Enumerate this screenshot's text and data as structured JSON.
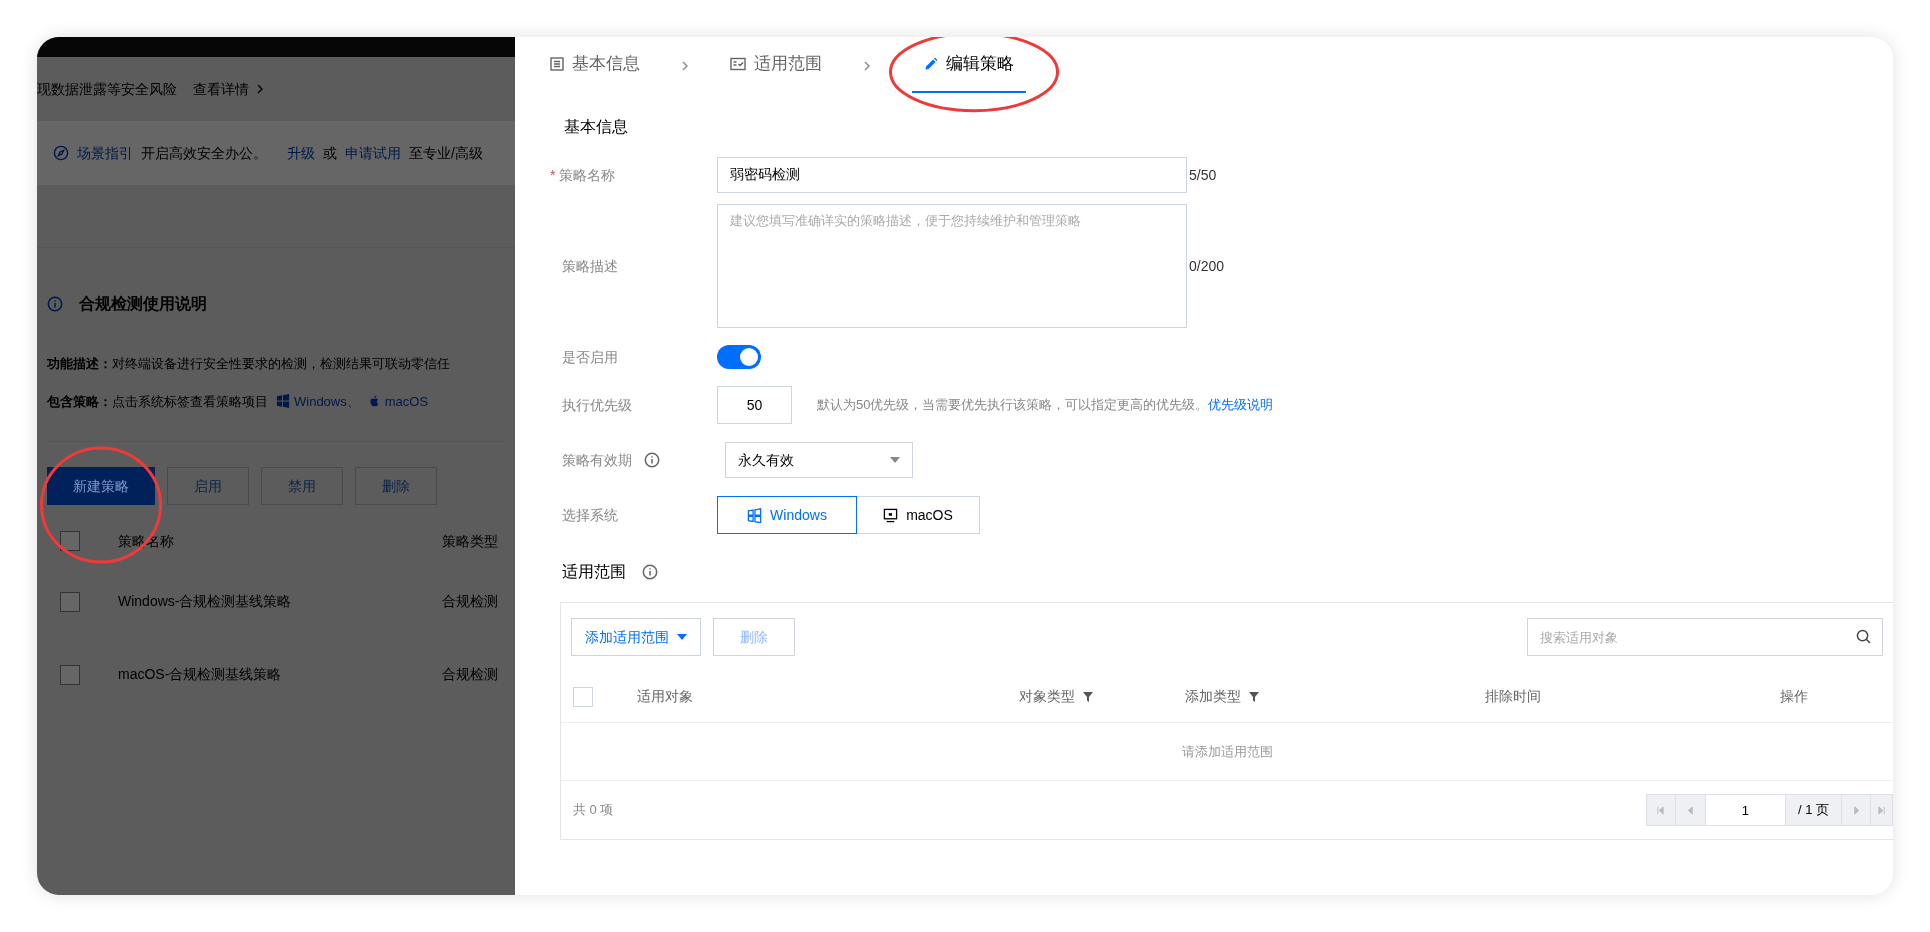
{
  "background_page": {
    "notice": {
      "text": "现数据泄露等安全风险",
      "link": "查看详情"
    },
    "banner": {
      "guide_link": "场景指引",
      "text_1": "开启高效安全办公。",
      "upgrade_link": "升级",
      "text_2": "或",
      "trial_link": "申请试用",
      "text_3": "至专业/高级"
    },
    "info": {
      "title": "合规检测使用说明",
      "description_label": "功能描述：",
      "description": "对终端设备进行安全性要求的检测，检测结果可联动零信任",
      "policies_label": "包含策略：",
      "policies_text": "点击系统标签查看策略项目",
      "systems": [
        {
          "kind": "windows",
          "label": "Windows、"
        },
        {
          "kind": "apple",
          "label": "macOS"
        }
      ]
    },
    "buttons": [
      {
        "label": "新建策略",
        "kind": "primary",
        "highlighted": true
      },
      {
        "label": "启用",
        "kind": "default",
        "highlighted": false
      },
      {
        "label": "禁用",
        "kind": "default",
        "highlighted": false
      },
      {
        "label": "删除",
        "kind": "default",
        "highlighted": false
      }
    ],
    "table": {
      "columns": [
        "策略名称",
        "策略类型"
      ],
      "header_checked": false,
      "rows": [
        {
          "checked": false,
          "cells": [
            "Windows-合规检测基线策略",
            "合规检测"
          ]
        },
        {
          "checked": false,
          "cells": [
            "macOS-合规检测基线策略",
            "合规检测"
          ]
        }
      ]
    }
  },
  "steps": [
    {
      "label": "基本信息",
      "kind": "list",
      "selected": false,
      "highlighted": false
    },
    {
      "label": "适用范围",
      "kind": "check",
      "selected": false,
      "highlighted": false
    },
    {
      "label": "编辑策略",
      "kind": "edit",
      "selected": true,
      "highlighted": true
    }
  ],
  "section_title": "基本信息",
  "form": {
    "name": {
      "label": "策略名称",
      "required_mark": "*",
      "value": "弱密码检测",
      "counter": "5/50"
    },
    "description": {
      "label": "策略描述",
      "placeholder": "建议您填写准确详实的策略描述，便于您持续维护和管理策略",
      "counter": "0/200"
    },
    "enabled": {
      "label": "是否启用",
      "on": true
    },
    "priority": {
      "label": "执行优先级",
      "value": "50",
      "hint": "默认为50优先级，当需要优先执行该策略，可以指定更高的优先级。",
      "link": "优先级说明"
    },
    "validity": {
      "label": "策略有效期",
      "value": "永久有效"
    },
    "system": {
      "label": "选择系统",
      "options": [
        {
          "label": "Windows",
          "kind": "windows",
          "selected": true
        },
        {
          "label": "macOS",
          "kind": "mac",
          "selected": false
        }
      ]
    }
  },
  "scope": {
    "title": "适用范围",
    "add_button": "添加适用范围",
    "delete_button": "删除",
    "search_placeholder": "搜索适用对象",
    "columns": [
      {
        "label": "适用对象",
        "filter": false
      },
      {
        "label": "对象类型",
        "filter": true
      },
      {
        "label": "添加类型",
        "filter": true
      },
      {
        "label": "排除时间",
        "filter": false
      },
      {
        "label": "操作",
        "filter": false
      }
    ],
    "header_checked": false,
    "empty_text": "请添加适用范围",
    "total": "共 0 项",
    "page_value": "1",
    "page_total": "/ 1 页"
  }
}
